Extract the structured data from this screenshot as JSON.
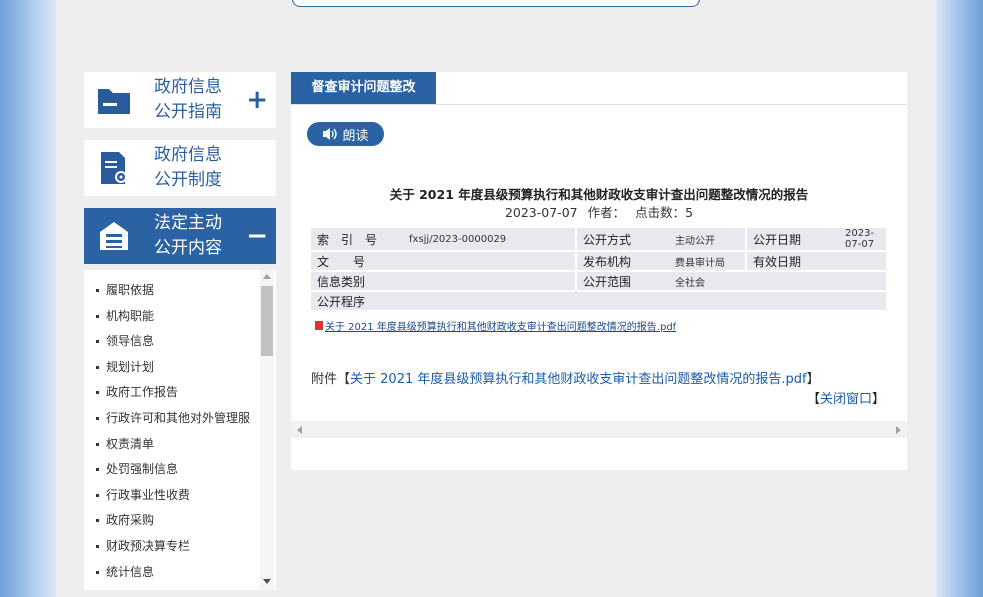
{
  "sidebar": {
    "cards": [
      {
        "label_line1": "政府信息",
        "label_line2": "公开指南",
        "sign": "+"
      },
      {
        "label_line1": "政府信息",
        "label_line2": "公开制度",
        "sign": ""
      },
      {
        "label_line1": "法定主动",
        "label_line2": "公开内容",
        "sign": "−"
      }
    ],
    "menu_items": [
      "履职依据",
      "机构职能",
      "领导信息",
      "规划计划",
      "政府工作报告",
      "行政许可和其他对外管理服",
      "权责清单",
      "处罚强制信息",
      "行政事业性收费",
      "政府采购",
      "财政预决算专栏",
      "统计信息"
    ]
  },
  "main": {
    "tab_label": "督查审计问题整改",
    "read_button": "朗读",
    "doc_title": "关于 2021 年度县级预算执行和其他财政收支审计查出问题整改情况的报告",
    "date": "2023-07-07",
    "author_label": "作者：",
    "clicks_label": "点击数：5",
    "info": {
      "index_key": "索　引　号",
      "index_val": "fxsjj/2023-0000029",
      "method_key": "公开方式",
      "method_val": "主动公开",
      "pubdate_key": "公开日期",
      "pubdate_val": "2023-07-07",
      "docno_key": "文　　号",
      "docno_val": "",
      "org_key": "发布机构",
      "org_val": "费县审计局",
      "valid_key": "有效日期",
      "valid_val": "",
      "cat_key": "信息类别",
      "cat_val": "",
      "scope_key": "公开范围",
      "scope_val": "全社会",
      "proc_key": "公开程序",
      "proc_val": ""
    },
    "pdf_link": "关于 2021 年度县级预算执行和其他财政收支审计查出问题整改情况的报告.pdf",
    "attach_prefix": "附件【",
    "attach_link": "关于 2021 年度县级预算执行和其他财政收支审计查出问题整改情况的报告.pdf",
    "attach_suffix": "】",
    "close_open": "【",
    "close_label": "关闭窗口",
    "close_close": "】"
  }
}
